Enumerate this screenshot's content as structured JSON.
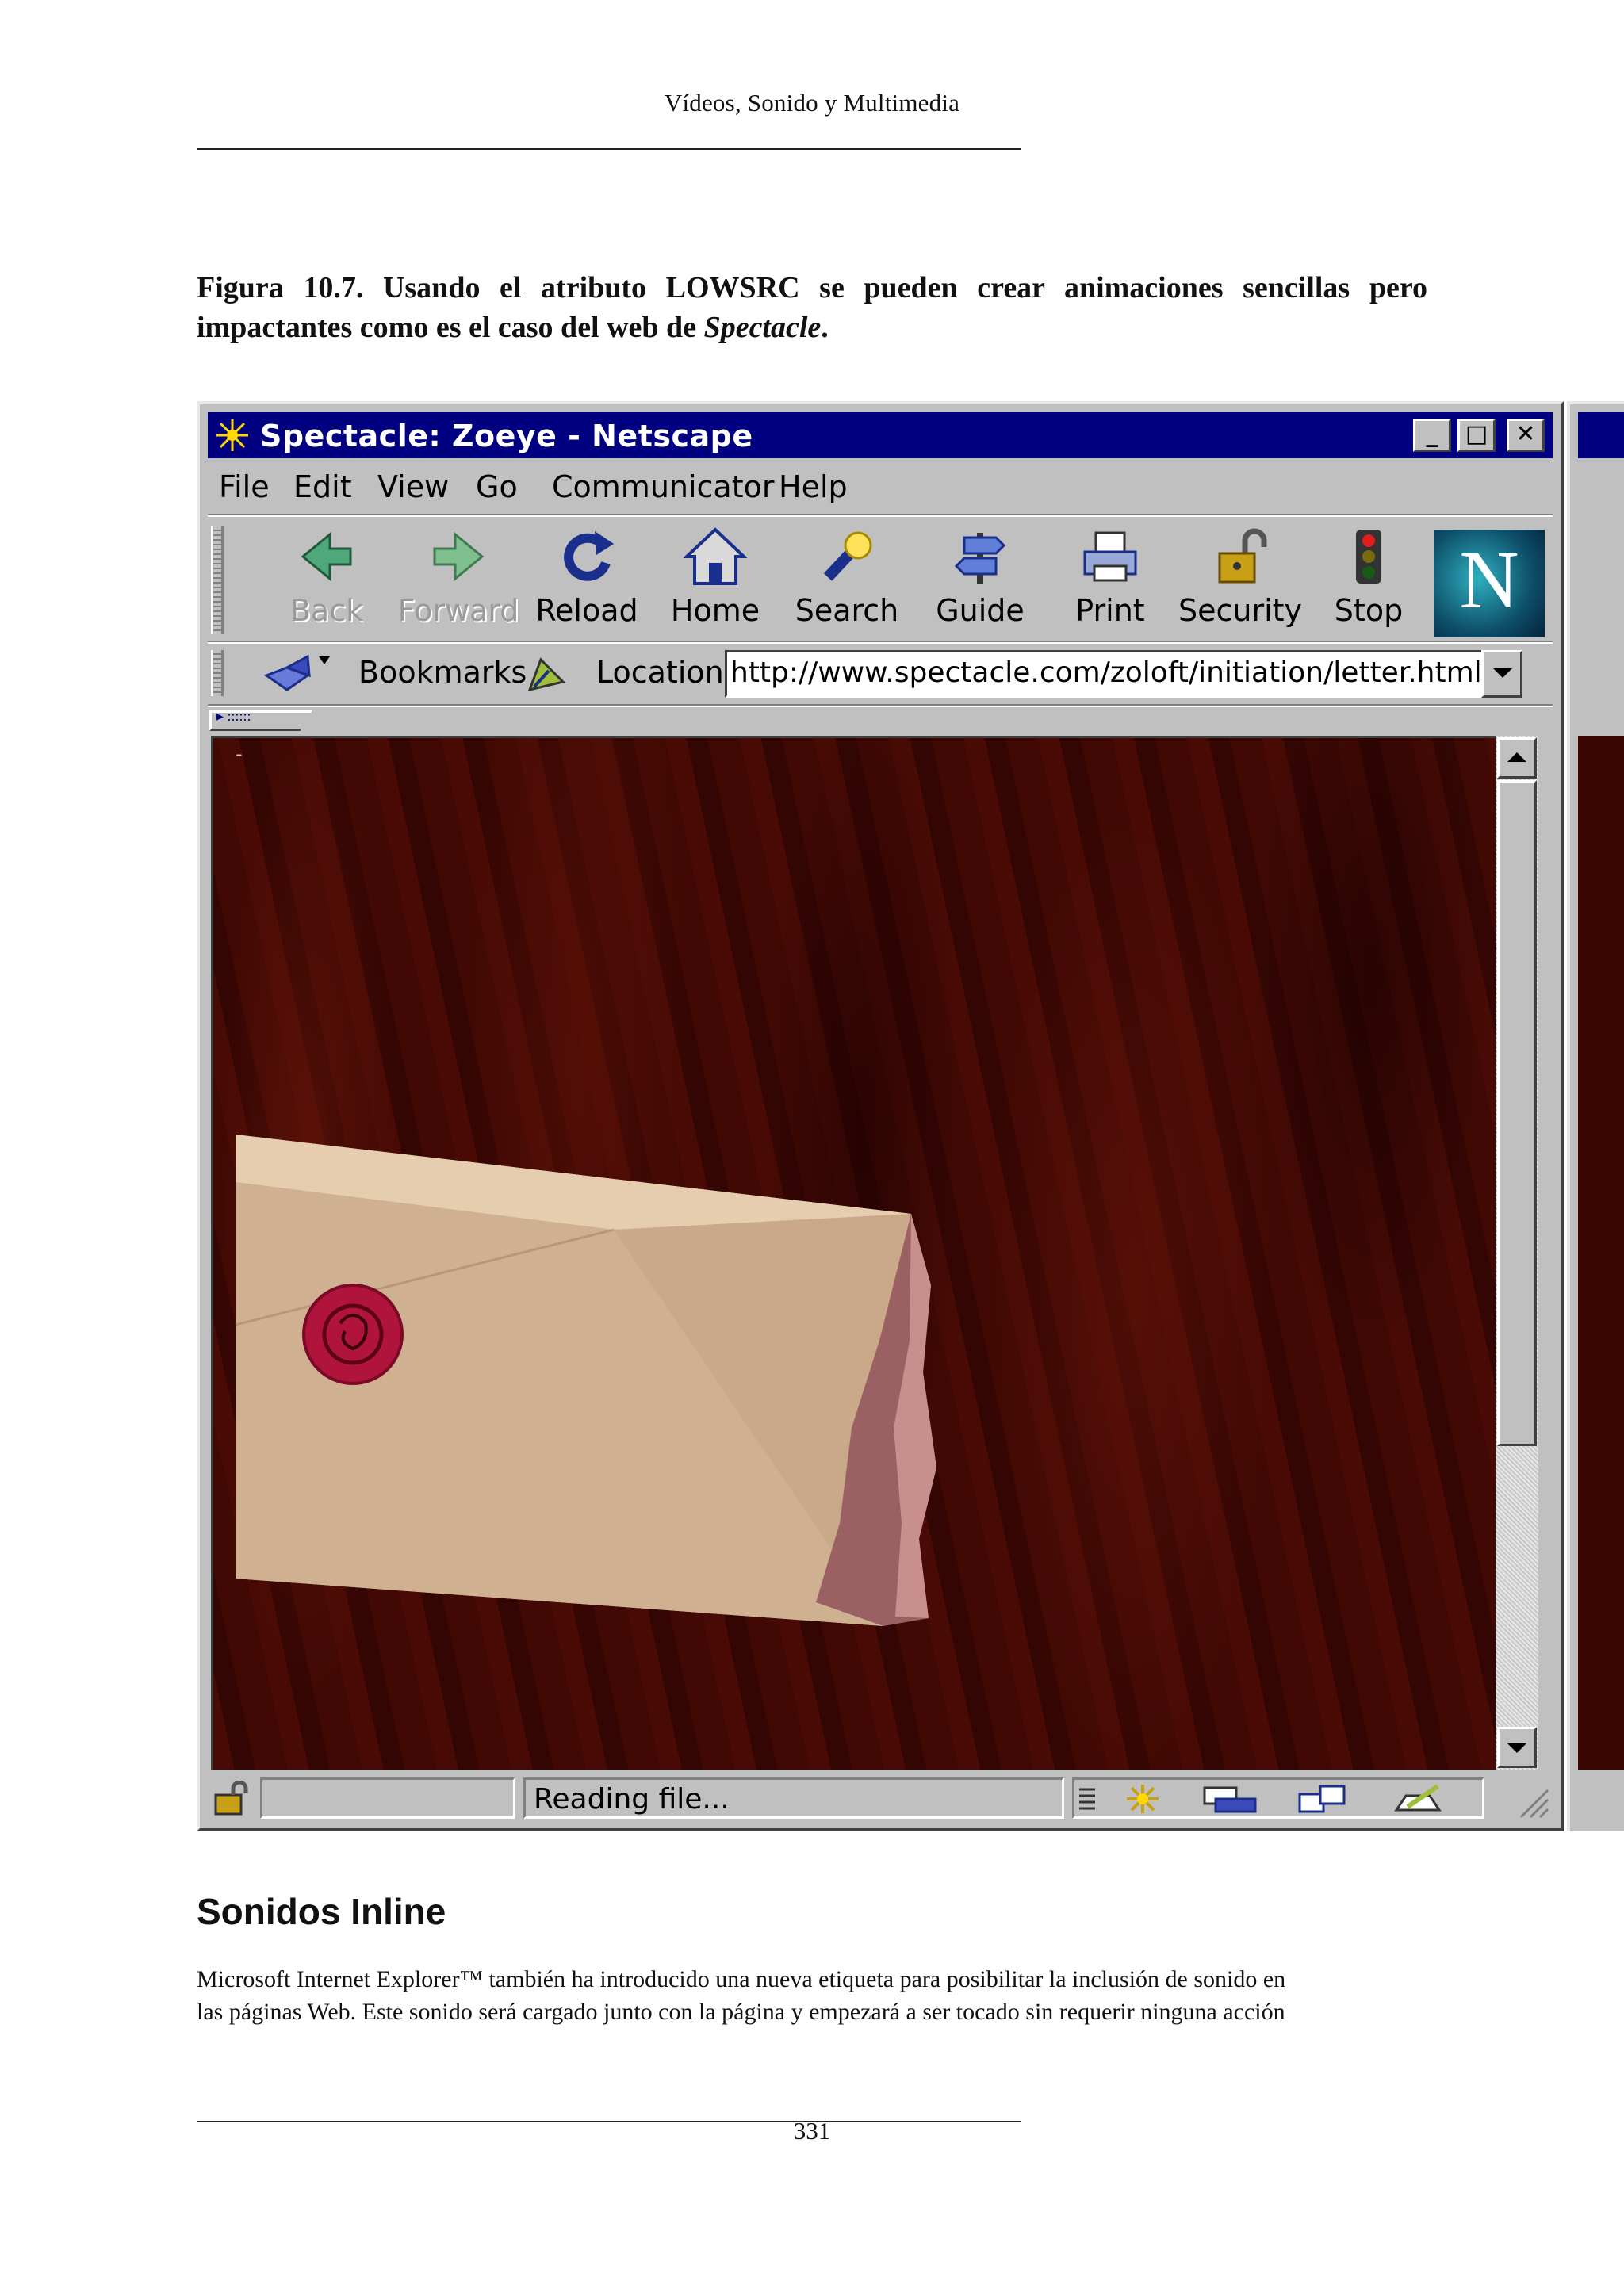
{
  "header": {
    "running_title": "Vídeos, Sonido y Multimedia"
  },
  "caption": {
    "text": "Figura 10.7.  Usando el atributo LOWSRC se pueden crear animaciones sencillas pero impactantes como es el caso del web de ",
    "italic": "Spectacle",
    "end": "."
  },
  "browser": {
    "title": "Spectacle: Zoeye - Netscape",
    "window_buttons": {
      "minimize": "_",
      "maximize": "□",
      "close": "✕"
    },
    "menu": [
      "File",
      "Edit",
      "View",
      "Go",
      "Communicator",
      "Help"
    ],
    "toolbar": [
      {
        "label": "Back",
        "icon": "back-arrow-icon",
        "enabled": false
      },
      {
        "label": "Forward",
        "icon": "forward-arrow-icon",
        "enabled": false
      },
      {
        "label": "Reload",
        "icon": "reload-icon",
        "enabled": true
      },
      {
        "label": "Home",
        "icon": "home-icon",
        "enabled": true
      },
      {
        "label": "Search",
        "icon": "search-icon",
        "enabled": true
      },
      {
        "label": "Guide",
        "icon": "guide-icon",
        "enabled": true
      },
      {
        "label": "Print",
        "icon": "printer-icon",
        "enabled": true
      },
      {
        "label": "Security",
        "icon": "padlock-icon",
        "enabled": true
      },
      {
        "label": "Stop",
        "icon": "traffic-light-icon",
        "enabled": true
      }
    ],
    "logo": "N",
    "bookmarks_label": "Bookmarks",
    "location_label": "Location:",
    "url": "http://www.spectacle.com/zoloft/initiation/letter.html",
    "status": "Reading file...",
    "colors": {
      "title_bar": "#000080",
      "chrome": "#c0c0c0",
      "wood": "#3b0703",
      "envelope": "#d8b99a",
      "seal": "#b0143c"
    }
  },
  "section": {
    "heading": "Sonidos Inline",
    "paragraph_line1": "Microsoft Internet Explorer™ también ha introducido una nueva etiqueta para posibilitar la inclusión de sonido en",
    "paragraph_line2": "las páginas Web.  Este sonido será cargado junto con la página y empezará a ser tocado sin requerir ninguna acción"
  },
  "footer": {
    "page_number": "331"
  }
}
